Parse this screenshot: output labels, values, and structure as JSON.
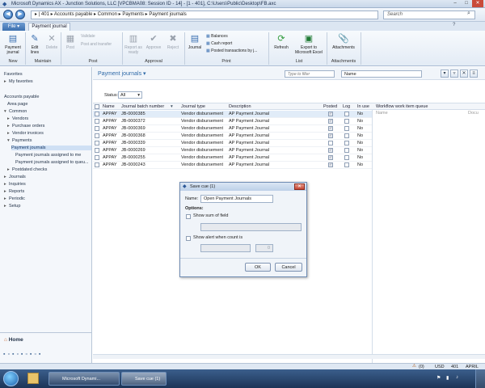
{
  "window": {
    "title": "Microsoft Dynamics AX - Junction Solutions, LLC [VPCBMA08: Session ID - 14] - [1 - 401], C:\\Users\\Public\\Desktop\\FB.axc",
    "min": "–",
    "max": "□",
    "close": "✕"
  },
  "address": {
    "back": "◀",
    "forward": "▶",
    "path": "▸ | 401 ▸ Accounts payable ▸ Common ▸ Payments ▸ Payment journals",
    "search_placeholder": "Search"
  },
  "tabs": {
    "file": "File ▾",
    "active": "Payment journal"
  },
  "ribbon": {
    "payment_journal": "Payment journal",
    "edit_lines": "Edit lines",
    "delete": "Delete",
    "post": "Post",
    "validate": "Validate",
    "post_transfer": "Post and transfer",
    "report_ready": "Report as ready",
    "approve": "Approve",
    "reject": "Reject",
    "journal": "Journal",
    "balances": "Balances",
    "cash_report": "Cash report",
    "posted_transactions": "Posted transactions by j...",
    "refresh": "Refresh",
    "export_excel": "Export to Microsoft Excel",
    "attachments": "Attachments",
    "groups": {
      "new": "New",
      "maintain": "Maintain",
      "post": "Post",
      "approval": "Approval",
      "print": "Print",
      "list": "List",
      "attachments": "Attachments"
    }
  },
  "nav": {
    "favorites": "Favorites",
    "my_favorites": "My favorites",
    "module": "Accounts payable",
    "area_page": "Area page",
    "common": "Common",
    "vendors": "Vendors",
    "purchase_orders": "Purchase orders",
    "vendor_invoices": "Vendor invoices",
    "payments": "Payments",
    "payment_journals": "Payment journals",
    "assigned_to_me": "Payment journals assigned to me",
    "assigned_to_queue": "Payment journals assigned to queu...",
    "postdated_checks": "Postdated checks",
    "journals": "Journals",
    "inquiries": "Inquiries",
    "reports": "Reports",
    "periodic": "Periodic",
    "setup": "Setup",
    "home": "Home"
  },
  "list": {
    "title": "Payment journals ▾",
    "filter_placeholder": "Type to filter",
    "filter_field": "Name",
    "status_label": "Status:",
    "status_value": "All",
    "columns": [
      "Name",
      "Journal batch number",
      "Journal type",
      "Description",
      "Posted",
      "Log",
      "In use",
      "Workflow work item queue"
    ],
    "wf_columns": [
      "Name",
      "Docu"
    ],
    "rows": [
      {
        "name": "APPAY",
        "batch": "JB-0000385",
        "type": "Vendor disbursement",
        "desc": "AP Payment Journal",
        "posted": true,
        "log": false,
        "inuse": "No"
      },
      {
        "name": "APPAY",
        "batch": "JB-0000372",
        "type": "Vendor disbursement",
        "desc": "AP Payment Journal",
        "posted": true,
        "log": false,
        "inuse": "No"
      },
      {
        "name": "APPAY",
        "batch": "JB-0000369",
        "type": "Vendor disbursement",
        "desc": "AP Payment Journal",
        "posted": true,
        "log": false,
        "inuse": "No"
      },
      {
        "name": "APPAY",
        "batch": "JB-0000368",
        "type": "Vendor disbursement",
        "desc": "AP Payment Journal",
        "posted": true,
        "log": false,
        "inuse": "No"
      },
      {
        "name": "APPAY",
        "batch": "JB-0000339",
        "type": "Vendor disbursement",
        "desc": "AP Payment Journal",
        "posted": false,
        "log": false,
        "inuse": "No"
      },
      {
        "name": "APPAY",
        "batch": "JB-0000269",
        "type": "Vendor disbursement",
        "desc": "AP Payment Journal",
        "posted": true,
        "log": false,
        "inuse": "No"
      },
      {
        "name": "APPAY",
        "batch": "JB-0000255",
        "type": "Vendor disbursement",
        "desc": "AP Payment Journal",
        "posted": true,
        "log": false,
        "inuse": "No"
      },
      {
        "name": "APPAY",
        "batch": "JB-0000243",
        "type": "Vendor disbursement",
        "desc": "AP Payment Journal",
        "posted": true,
        "log": false,
        "inuse": "No"
      }
    ]
  },
  "dialog": {
    "title": "Save cue (1)",
    "name_label": "Name:",
    "name_value": "Open Payment Journals",
    "options": "Options:",
    "show_sum": "Show sum of field",
    "show_alert": "Show alert when count is",
    "count_value": "0",
    "ok": "OK",
    "cancel": "Cancel"
  },
  "statusbar": {
    "notes": "(0)",
    "currency": "USD",
    "company": "401",
    "layer": "APRIL"
  },
  "taskbar": {
    "app": "Microsoft Dynami...",
    "dialog": "Save cue (1)"
  },
  "colors": {
    "accent": "#2f6aa8",
    "selected_row": "#e1ecf8",
    "ribbon_bg": "#e3ebf5"
  }
}
